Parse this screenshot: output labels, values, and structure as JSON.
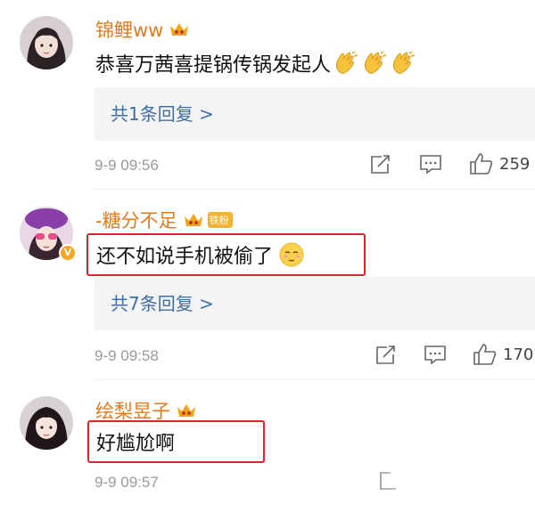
{
  "comments": [
    {
      "username": "锦鲤ww",
      "text": "恭喜万茜喜提锅传锅发起人",
      "replies_label": "共1条回复 >",
      "timestamp": "9-9 09:56",
      "likes": "259",
      "vip_icon": "crown-icon",
      "emoji": "clapping-hands",
      "highlighted": false
    },
    {
      "username": "-糖分不足",
      "fan_badge": "铁粉",
      "text": "还不如说手机被偷了",
      "replies_label": "共7条回复 >",
      "timestamp": "9-9 09:58",
      "likes": "170",
      "vip_icon": "crown-icon",
      "emoji": "relieved-face",
      "verified": true,
      "highlighted": true
    },
    {
      "username": "绘梨昱子",
      "text": "好尴尬啊",
      "timestamp": "9-9 09:57",
      "vip_icon": "crown-icon",
      "highlighted": true
    }
  ],
  "colors": {
    "username": "#e07a1e",
    "link": "#3d6fa8",
    "highlight_border": "#d9252b",
    "meta": "#9a9a9a"
  }
}
